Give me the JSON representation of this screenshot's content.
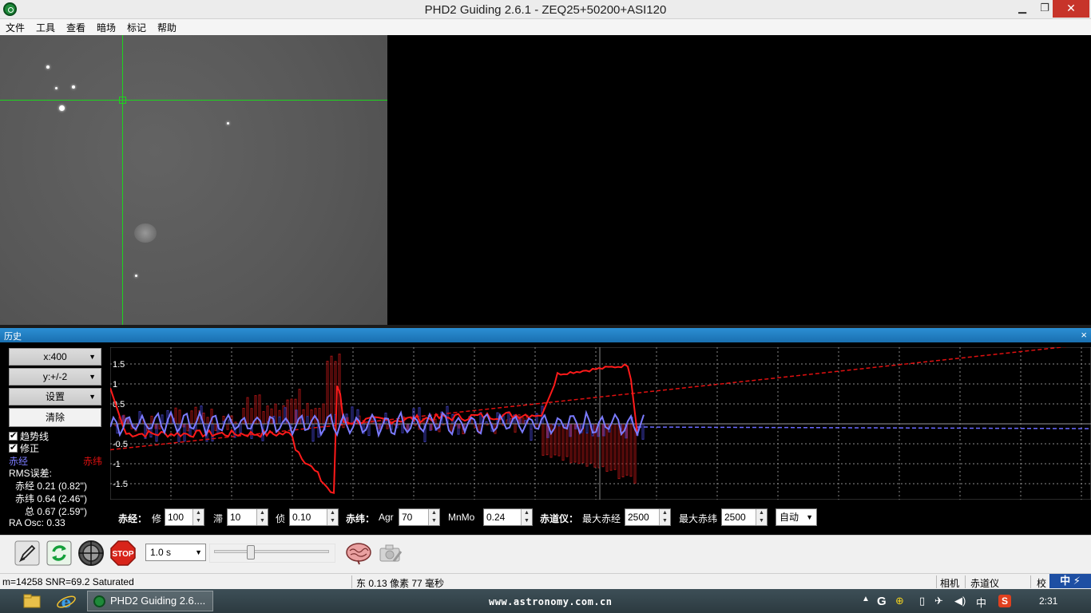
{
  "window": {
    "title": "PHD2 Guiding 2.6.1 - ZEQ25+50200+ASI120",
    "minimize": "▁",
    "maximize": "❐",
    "close": "✕"
  },
  "menu": [
    "文件",
    "工具",
    "查看",
    "暗场",
    "标记",
    "帮助"
  ],
  "history": {
    "title": "历史",
    "close": "×",
    "x_scale": "x:400",
    "y_scale": "y:+/-2",
    "settings": "设置",
    "clear": "清除",
    "trend_label": "趋势线",
    "correction_label": "修正",
    "ra_legend": "赤经",
    "dec_legend": "赤纬",
    "ra_color": "#7b7bff",
    "dec_color": "#e01010",
    "rms_title": "RMS误差:",
    "rms_ra": "赤经 0.21 (0.82'')",
    "rms_dec": "赤纬 0.64 (2.46'')",
    "rms_total": "总 0.67 (2.59'')",
    "ra_osc": "RA Osc: 0.33",
    "y_ticks": [
      "1.5",
      "1",
      "0.5",
      "-0.5",
      "-1",
      "-1.5"
    ]
  },
  "controls": {
    "ra_label": "赤经：",
    "ra_hyst_label": "修",
    "ra_hyst": "100",
    "ra_stop_label": "滞",
    "ra_stop": "10",
    "ra_min_label": "侦",
    "ra_min": "0.10",
    "dec_label": "赤纬：",
    "dec_agr_label": "Agr",
    "dec_agr": "70",
    "dec_mnmo_label": "MnMo",
    "dec_mnmo": "0.24",
    "mount_label": "赤道仪：",
    "max_ra_label": "最大赤经",
    "max_ra": "2500",
    "max_dec_label": "最大赤纬",
    "max_dec": "2500",
    "dec_mode": "自动"
  },
  "toolbar": {
    "exposure": "1.0 s"
  },
  "status": {
    "star_info": "m=14258 SNR=69.2 Saturated",
    "guide_info": "东  0.13 像素   77 毫秒",
    "camera": "相机",
    "mount": "赤道仪",
    "cal": "校"
  },
  "ime": "中",
  "taskbar": {
    "task_title": "PHD2 Guiding 2.6....",
    "watermark": "www.astronomy.com.cn",
    "ime_tray": "中",
    "clock": "2:31"
  },
  "chart_data": {
    "type": "line",
    "ylim": [
      -2,
      2
    ],
    "y_ticks": [
      1.5,
      1,
      0.5,
      -0.5,
      -1,
      -1.5
    ],
    "series": [
      {
        "name": "赤经",
        "color": "#7b7bff"
      },
      {
        "name": "赤纬",
        "color": "#e01010"
      }
    ]
  }
}
